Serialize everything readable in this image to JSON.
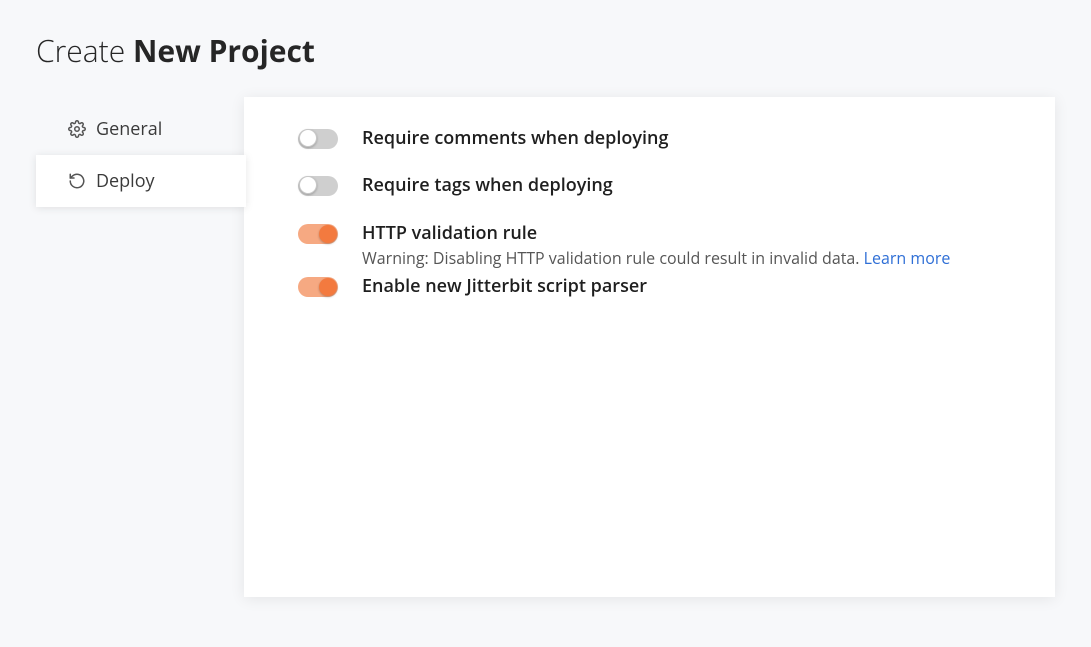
{
  "title": {
    "prefix": "Create ",
    "bold": "New Project"
  },
  "tabs": {
    "general": {
      "label": "General"
    },
    "deploy": {
      "label": "Deploy"
    }
  },
  "settings": {
    "requireComments": {
      "label": "Require comments when deploying",
      "enabled": false
    },
    "requireTags": {
      "label": "Require tags when deploying",
      "enabled": false
    },
    "httpValidation": {
      "label": "HTTP validation rule",
      "caption": "Warning: Disabling HTTP validation rule could result in invalid data. ",
      "learnMore": "Learn more",
      "enabled": true
    },
    "scriptParser": {
      "label": "Enable new Jitterbit script parser",
      "enabled": true
    }
  }
}
